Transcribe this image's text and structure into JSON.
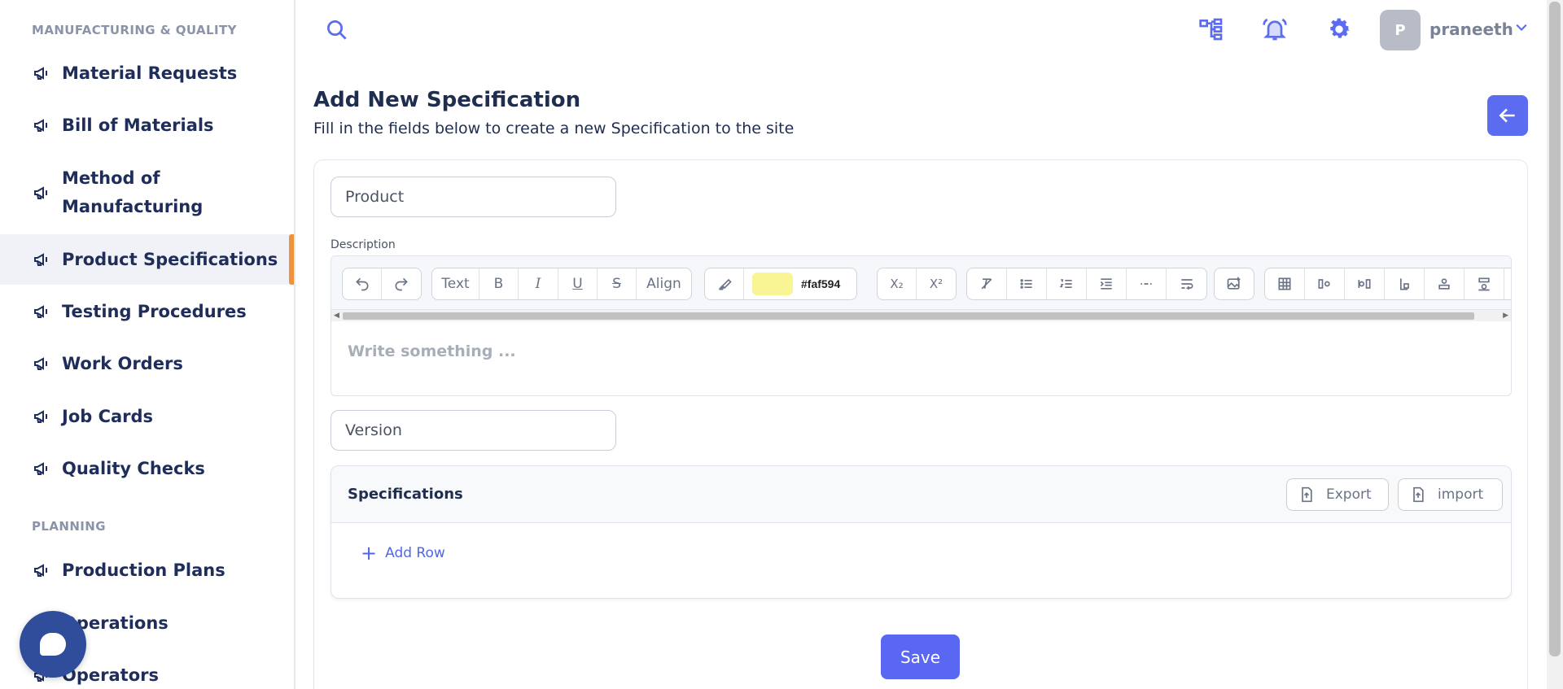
{
  "sidebar": {
    "sections": [
      {
        "title": "MANUFACTURING & QUALITY"
      },
      {
        "title": "PLANNING"
      }
    ],
    "items": [
      {
        "label": "Material Requests"
      },
      {
        "label": "Bill of Materials"
      },
      {
        "label": "Method of Manufacturing"
      },
      {
        "label": "Product Specifications"
      },
      {
        "label": "Testing Procedures"
      },
      {
        "label": "Work Orders"
      },
      {
        "label": "Job Cards"
      },
      {
        "label": "Quality Checks"
      },
      {
        "label": "Production Plans"
      },
      {
        "label": "Operations"
      },
      {
        "label": "Operators"
      }
    ],
    "active_item": "Product Specifications",
    "item_icon": "megaphone-icon"
  },
  "header": {
    "user": {
      "initial": "P",
      "name": "praneeth"
    },
    "icons": [
      "search-icon",
      "org-chart-icon",
      "bell-icon",
      "gear-icon",
      "chevron-down-icon"
    ]
  },
  "page": {
    "title": "Add New Specification",
    "subtitle": "Fill in the fields below to create a new Specification to the site"
  },
  "form": {
    "product_placeholder": "Product",
    "description_label": "Description",
    "editor": {
      "text_label": "Text",
      "bold_label": "B",
      "italic_label": "I",
      "underline_label": "U",
      "strike_label": "S",
      "align_label": "Align",
      "color_value": "#faf594",
      "subscript_label": "X₂",
      "superscript_label": "X²",
      "placeholder": "Write something ..."
    },
    "version_placeholder": "Version"
  },
  "specifications": {
    "title": "Specifications",
    "export_label": "Export",
    "import_label": "import",
    "add_row_label": "Add Row"
  },
  "actions": {
    "save_label": "Save"
  },
  "colors": {
    "accent": "#5a67f2",
    "active_indicator": "#f0923a",
    "nav_text": "#1f2d5a",
    "chat_bubble": "#2f4d9a"
  }
}
